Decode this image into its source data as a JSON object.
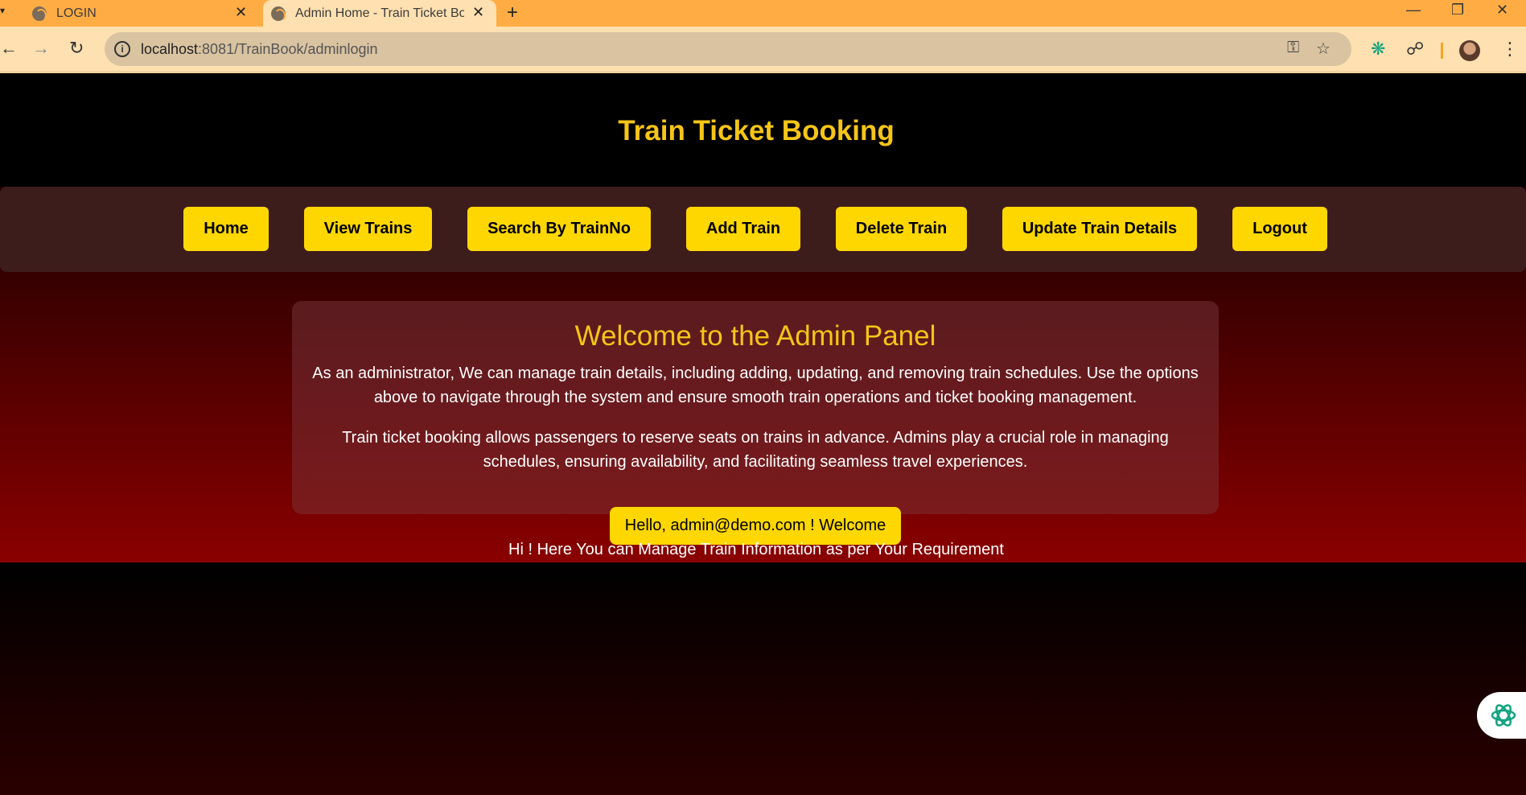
{
  "browser": {
    "tabs": [
      {
        "title": "LOGIN",
        "active": false
      },
      {
        "title": "Admin Home - Train Ticket Boo",
        "active": true
      }
    ],
    "new_tab_icon": "plus-icon",
    "url_host": "localhost",
    "url_rest": ":8081/TrainBook/adminlogin",
    "colors": {
      "tabstrip": "#ffac45",
      "toolbar": "#ffe0b0"
    }
  },
  "header": {
    "title": "Train Ticket Booking"
  },
  "nav": {
    "items": [
      {
        "label": "Home"
      },
      {
        "label": "View Trains"
      },
      {
        "label": "Search By TrainNo"
      },
      {
        "label": "Add Train"
      },
      {
        "label": "Delete Train"
      },
      {
        "label": "Update Train Details"
      },
      {
        "label": "Logout"
      }
    ],
    "button_color": "#ffd700"
  },
  "panel": {
    "heading": "Welcome to the Admin Panel",
    "para1": "As an administrator, We can manage train details, including adding, updating, and removing train schedules. Use the options above to navigate through the system and ensure smooth train operations and ticket booking management.",
    "para2": "Train ticket booking allows passengers to reserve seats on trains in advance. Admins play a crucial role in managing schedules, ensuring availability, and facilitating seamless travel experiences."
  },
  "greeting": {
    "hello": "Hello, admin@demo.com ! Welcome",
    "message": "Hi ! Here You can Manage Train Information as per Your Requirement"
  },
  "accent_color": "#f5c518"
}
